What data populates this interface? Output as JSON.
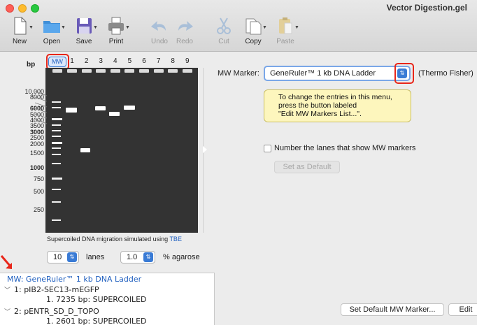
{
  "window": {
    "title": "Vector Digestion.gel"
  },
  "toolbar": {
    "new": "New",
    "open": "Open",
    "save": "Save",
    "print": "Print",
    "undo": "Undo",
    "redo": "Redo",
    "cut": "Cut",
    "copy": "Copy",
    "paste": "Paste"
  },
  "gel": {
    "bp_label": "bp",
    "mw_tab": "MW",
    "lanes": [
      "1",
      "2",
      "3",
      "4",
      "5",
      "6",
      "7",
      "8",
      "9"
    ],
    "size_labels": [
      {
        "text": "10,000",
        "bold": false
      },
      {
        "text": "8000",
        "bold": false
      },
      {
        "text": "6000",
        "bold": true
      },
      {
        "text": "5000",
        "bold": false
      },
      {
        "text": "4000",
        "bold": false
      },
      {
        "text": "3500",
        "bold": false
      },
      {
        "text": "3000",
        "bold": true
      },
      {
        "text": "2500",
        "bold": false
      },
      {
        "text": "2000",
        "bold": false
      },
      {
        "text": "1500",
        "bold": false
      },
      {
        "text": "1000",
        "bold": true
      },
      {
        "text": "750",
        "bold": false
      },
      {
        "text": "500",
        "bold": false
      },
      {
        "text": "250",
        "bold": false
      }
    ],
    "caption_prefix": "Supercoiled DNA migration simulated using ",
    "caption_link": "TBE",
    "lanes_value": "10",
    "lanes_label": "lanes",
    "agarose_value": "1.0",
    "agarose_label": "% agarose"
  },
  "list": {
    "mw_line": "MW:  GeneRuler™ 1 kb DNA Ladder",
    "items": [
      {
        "title": "1:  pIB2-SEC13-mEGFP",
        "detail": "1.  7235 bp:  SUPERCOILED"
      },
      {
        "title": "2:  pENTR_SD_D_TOPO",
        "detail": "1.  2601 bp:  SUPERCOILED"
      }
    ]
  },
  "marker": {
    "label": "MW Marker:",
    "selected": "GeneRuler™ 1 kb DNA Ladder",
    "vendor": "(Thermo Fisher)",
    "tooltip": [
      "To change the entries in this menu,",
      "press the button labeled",
      "\"Edit MW Markers List...\"."
    ],
    "checkbox_label": "Number the lanes that show MW markers",
    "set_default": "Set as Default"
  },
  "footer": {
    "set_default_marker": "Set Default MW Marker...",
    "edit": "Edit"
  },
  "colors": {
    "accent": "#3a7bd5",
    "highlight": "#e8261a",
    "gel": "#333333"
  }
}
